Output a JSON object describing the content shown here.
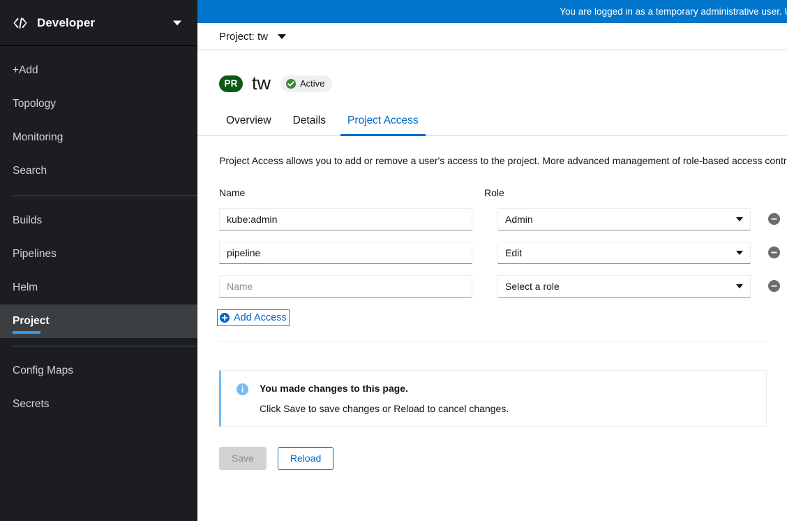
{
  "sidebar": {
    "perspective": {
      "label": "Developer",
      "icon": "code-icon",
      "caret": "chevron-down-icon"
    },
    "items": [
      {
        "label": "+Add",
        "name": "add",
        "active": false,
        "sep_after": false
      },
      {
        "label": "Topology",
        "name": "topology",
        "active": false,
        "sep_after": false
      },
      {
        "label": "Monitoring",
        "name": "monitoring",
        "active": false,
        "sep_after": false
      },
      {
        "label": "Search",
        "name": "search",
        "active": false,
        "sep_after": true
      },
      {
        "label": "Builds",
        "name": "builds",
        "active": false,
        "sep_after": false
      },
      {
        "label": "Pipelines",
        "name": "pipelines",
        "active": false,
        "sep_after": false
      },
      {
        "label": "Helm",
        "name": "helm",
        "active": false,
        "sep_after": false
      },
      {
        "label": "Project",
        "name": "project",
        "active": true,
        "sep_after": true
      },
      {
        "label": "Config Maps",
        "name": "config-maps",
        "active": false,
        "sep_after": false
      },
      {
        "label": "Secrets",
        "name": "secrets",
        "active": false,
        "sep_after": false
      }
    ]
  },
  "banner": {
    "text": "You are logged in as a temporary administrative user. Update th",
    "background": "#0076cd"
  },
  "project_bar": {
    "label": "Project: tw"
  },
  "header": {
    "badge": "PR",
    "badge_color": "#0b5b13",
    "title": "tw",
    "status": "Active",
    "status_icon": "check-circle-icon",
    "status_color": "#3e8635"
  },
  "tabs": [
    {
      "label": "Overview",
      "name": "overview",
      "selected": false
    },
    {
      "label": "Details",
      "name": "details",
      "selected": false
    },
    {
      "label": "Project Access",
      "name": "project-access",
      "selected": true
    }
  ],
  "main": {
    "description": "Project Access allows you to add or remove a user's access to the project. More advanced management of role-based access contro",
    "column_headers": {
      "name": "Name",
      "role": "Role"
    },
    "rows": [
      {
        "name_value": "kube:admin",
        "name_placeholder": "Name",
        "role_value": "Admin",
        "is_placeholder_name": false,
        "is_placeholder_role": false
      },
      {
        "name_value": "pipeline",
        "name_placeholder": "Name",
        "role_value": "Edit",
        "is_placeholder_name": false,
        "is_placeholder_role": false
      },
      {
        "name_value": "",
        "name_placeholder": "Name",
        "role_value": "Select a role",
        "is_placeholder_name": true,
        "is_placeholder_role": true
      }
    ],
    "add_access_label": "Add Access",
    "remove_icon": "minus-circle-icon"
  },
  "alert": {
    "icon": "info-circle-icon",
    "title": "You made changes to this page.",
    "text": "Click Save to save changes or Reload to cancel changes.",
    "accent": "#73bcf7"
  },
  "buttons": {
    "save": "Save",
    "reload": "Reload"
  },
  "accent_color": "#0066cc"
}
